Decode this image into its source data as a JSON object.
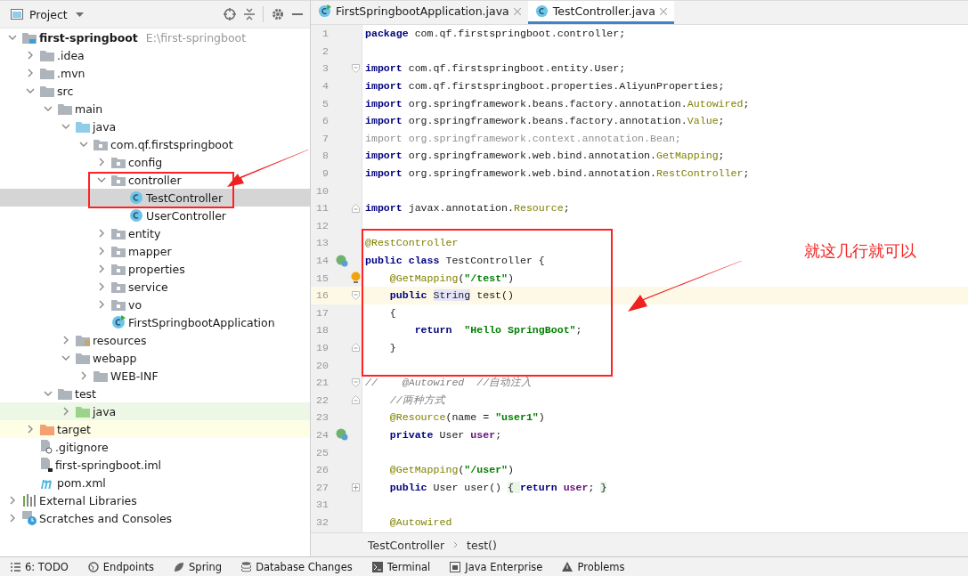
{
  "project_panel": {
    "title": "Project",
    "tree": [
      {
        "label": "first-springboot",
        "path": "E:\\first-springboot",
        "kind": "module",
        "expanded": true,
        "selected": false,
        "children": [
          {
            "label": ".idea",
            "kind": "folder",
            "expanded": false,
            "selected": false
          },
          {
            "label": ".mvn",
            "kind": "folder",
            "expanded": false,
            "selected": false
          },
          {
            "label": "src",
            "kind": "folder",
            "expanded": true,
            "selected": false,
            "children": [
              {
                "label": "main",
                "kind": "folder",
                "expanded": true,
                "selected": false,
                "children": [
                  {
                    "label": "java",
                    "kind": "source",
                    "expanded": true,
                    "selected": false,
                    "children": [
                      {
                        "label": "com.qf.firstspringboot",
                        "kind": "package",
                        "expanded": true,
                        "selected": false,
                        "children": [
                          {
                            "label": "config",
                            "kind": "package",
                            "expanded": false,
                            "selected": false
                          },
                          {
                            "label": "controller",
                            "kind": "package",
                            "expanded": true,
                            "selected": false,
                            "children": [
                              {
                                "label": "TestController",
                                "kind": "class",
                                "selected": true
                              },
                              {
                                "label": "UserController",
                                "kind": "class",
                                "selected": false
                              }
                            ]
                          },
                          {
                            "label": "entity",
                            "kind": "package",
                            "expanded": false,
                            "selected": false
                          },
                          {
                            "label": "mapper",
                            "kind": "package",
                            "expanded": false,
                            "selected": false
                          },
                          {
                            "label": "properties",
                            "kind": "package",
                            "expanded": false,
                            "selected": false
                          },
                          {
                            "label": "service",
                            "kind": "package",
                            "expanded": false,
                            "selected": false
                          },
                          {
                            "label": "vo",
                            "kind": "package",
                            "expanded": false,
                            "selected": false
                          },
                          {
                            "label": "FirstSpringbootApplication",
                            "kind": "app",
                            "selected": false
                          }
                        ]
                      }
                    ]
                  },
                  {
                    "label": "resources",
                    "kind": "resources",
                    "expanded": false,
                    "selected": false
                  },
                  {
                    "label": "webapp",
                    "kind": "folder",
                    "expanded": true,
                    "selected": false,
                    "children": [
                      {
                        "label": "WEB-INF",
                        "kind": "folder",
                        "expanded": false,
                        "selected": false
                      }
                    ]
                  }
                ]
              },
              {
                "label": "test",
                "kind": "folder",
                "expanded": true,
                "selected": false,
                "children": [
                  {
                    "label": "java",
                    "kind": "test-source",
                    "expanded": false,
                    "selected": false
                  }
                ]
              }
            ]
          },
          {
            "label": "target",
            "kind": "excluded",
            "expanded": false,
            "selected": false
          },
          {
            "label": ".gitignore",
            "kind": "ignore-file",
            "selected": false
          },
          {
            "label": "first-springboot.iml",
            "kind": "iml-file",
            "selected": false
          },
          {
            "label": "pom.xml",
            "kind": "maven",
            "selected": false
          }
        ]
      },
      {
        "label": "External Libraries",
        "kind": "libraries",
        "expanded": false,
        "selected": false
      },
      {
        "label": "Scratches and Consoles",
        "kind": "scratches",
        "expanded": false,
        "selected": false
      }
    ]
  },
  "editor": {
    "tabs": [
      {
        "label": "FirstSpringbootApplication.java",
        "kind": "app",
        "selected": false
      },
      {
        "label": "TestController.java",
        "kind": "class",
        "selected": true
      }
    ],
    "lines": [
      {
        "n": "1",
        "tokens": [
          {
            "t": "package",
            "kind": "keyword"
          },
          {
            "t": " com.qf.firstspringboot.controller;",
            "kind": "plain"
          }
        ]
      },
      {
        "n": "2"
      },
      {
        "n": "3",
        "marks": [
          {
            "kind": "fold-start"
          }
        ],
        "tokens": [
          {
            "t": "import",
            "kind": "keyword"
          },
          {
            "t": " com.qf.firstspringboot.entity.User;",
            "kind": "plain"
          }
        ]
      },
      {
        "n": "4",
        "tokens": [
          {
            "t": "import",
            "kind": "keyword"
          },
          {
            "t": " com.qf.firstspringboot.properties.AliyunProperties;",
            "kind": "plain"
          }
        ]
      },
      {
        "n": "5",
        "tokens": [
          {
            "t": "import",
            "kind": "keyword"
          },
          {
            "t": " org.springframework.beans.factory.annotation.",
            "kind": "plain"
          },
          {
            "t": "Autowired",
            "kind": "annotation"
          },
          {
            "t": ";",
            "kind": "plain"
          }
        ]
      },
      {
        "n": "6",
        "tokens": [
          {
            "t": "import",
            "kind": "keyword"
          },
          {
            "t": " org.springframework.beans.factory.annotation.",
            "kind": "plain"
          },
          {
            "t": "Value",
            "kind": "annotation"
          },
          {
            "t": ";",
            "kind": "plain"
          }
        ]
      },
      {
        "n": "7",
        "tokens": [
          {
            "t": "import org.springframework.context.annotation.Bean;",
            "kind": "unused"
          }
        ]
      },
      {
        "n": "8",
        "tokens": [
          {
            "t": "import",
            "kind": "keyword"
          },
          {
            "t": " org.springframework.web.bind.annotation.",
            "kind": "plain"
          },
          {
            "t": "GetMapping",
            "kind": "annotation"
          },
          {
            "t": ";",
            "kind": "plain"
          }
        ]
      },
      {
        "n": "9",
        "tokens": [
          {
            "t": "import",
            "kind": "keyword"
          },
          {
            "t": " org.springframework.web.bind.annotation.",
            "kind": "plain"
          },
          {
            "t": "RestController",
            "kind": "annotation"
          },
          {
            "t": ";",
            "kind": "plain"
          }
        ]
      },
      {
        "n": "10"
      },
      {
        "n": "11",
        "marks": [
          {
            "kind": "fold-end"
          }
        ],
        "tokens": [
          {
            "t": "import",
            "kind": "keyword"
          },
          {
            "t": " javax.annotation.",
            "kind": "plain"
          },
          {
            "t": "Resource",
            "kind": "annotation"
          },
          {
            "t": ";",
            "kind": "plain"
          }
        ]
      },
      {
        "n": "12"
      },
      {
        "n": "13",
        "tokens": [
          {
            "t": "@RestController",
            "kind": "annotation"
          }
        ]
      },
      {
        "n": "14",
        "marks": [
          {
            "kind": "bean"
          }
        ],
        "tokens": [
          {
            "t": "public class",
            "kind": "keyword"
          },
          {
            "t": " TestController {",
            "kind": "plain"
          }
        ]
      },
      {
        "n": "15",
        "marks": [
          {
            "kind": "bulb"
          }
        ],
        "tokens": [
          {
            "t": "    @GetMapping",
            "kind": "annotation"
          },
          {
            "t": "(",
            "kind": "plain"
          },
          {
            "t": "\"/test\"",
            "kind": "string"
          },
          {
            "t": ")",
            "kind": "plain"
          }
        ]
      },
      {
        "n": "16",
        "current": true,
        "marks": [
          {
            "kind": "fold-start"
          }
        ],
        "tokens": [
          {
            "t": "    public ",
            "kind": "keyword"
          },
          {
            "t": "String",
            "kind": "highlight"
          },
          {
            "t": " test()",
            "kind": "plain"
          }
        ]
      },
      {
        "n": "17",
        "tokens": [
          {
            "t": "    {",
            "kind": "plain"
          }
        ]
      },
      {
        "n": "18",
        "tokens": [
          {
            "t": "        return",
            "kind": "keyword"
          },
          {
            "t": "  \"Hello SpringBoot\"",
            "kind": "string"
          },
          {
            "t": ";",
            "kind": "plain"
          }
        ]
      },
      {
        "n": "19",
        "marks": [
          {
            "kind": "fold-end"
          }
        ],
        "tokens": [
          {
            "t": "    }",
            "kind": "plain"
          }
        ]
      },
      {
        "n": "20"
      },
      {
        "n": "21",
        "marks": [
          {
            "kind": "fold-start"
          }
        ],
        "tokens": [
          {
            "t": "//    @Autowired  //自动注入",
            "kind": "comment"
          }
        ]
      },
      {
        "n": "22",
        "marks": [
          {
            "kind": "fold-end"
          }
        ],
        "tokens": [
          {
            "t": "    //两种方式",
            "kind": "comment"
          }
        ]
      },
      {
        "n": "23",
        "tokens": [
          {
            "t": "    @Resource",
            "kind": "annotation"
          },
          {
            "t": "(name = ",
            "kind": "plain"
          },
          {
            "t": "\"user1\"",
            "kind": "string"
          },
          {
            "t": ")",
            "kind": "plain"
          }
        ]
      },
      {
        "n": "24",
        "marks": [
          {
            "kind": "bean"
          }
        ],
        "tokens": [
          {
            "t": "    private",
            "kind": "keyword"
          },
          {
            "t": " User ",
            "kind": "plain"
          },
          {
            "t": "user",
            "kind": "field"
          },
          {
            "t": ";",
            "kind": "plain"
          }
        ]
      },
      {
        "n": "25"
      },
      {
        "n": "26",
        "tokens": [
          {
            "t": "    @GetMapping",
            "kind": "annotation"
          },
          {
            "t": "(",
            "kind": "plain"
          },
          {
            "t": "\"/user\"",
            "kind": "string"
          },
          {
            "t": ")",
            "kind": "plain"
          }
        ]
      },
      {
        "n": "27",
        "marks": [
          {
            "kind": "fold-collapsed"
          }
        ],
        "tokens": [
          {
            "t": "    public",
            "kind": "keyword"
          },
          {
            "t": " User user() ",
            "kind": "plain"
          },
          {
            "t": "{ ",
            "kind": "folded"
          },
          {
            "t": "return",
            "kind": "keyword"
          },
          {
            "t": " user",
            "kind": "field"
          },
          {
            "t": "; ",
            "kind": "plain"
          },
          {
            "t": "}",
            "kind": "folded"
          }
        ]
      },
      {
        "n": "31"
      },
      {
        "n": "32",
        "tokens": [
          {
            "t": "    @Autowired",
            "kind": "annotation"
          }
        ]
      }
    ],
    "breadcrumb": [
      "TestController",
      "test()"
    ]
  },
  "annotation": {
    "text": "就这几行就可以"
  },
  "tool_windows": [
    {
      "label": "6: TODO",
      "kind": "todo"
    },
    {
      "label": "Endpoints",
      "kind": "endpoints"
    },
    {
      "label": "Spring",
      "kind": "spring"
    },
    {
      "label": "Database Changes",
      "kind": "database"
    },
    {
      "label": "Terminal",
      "kind": "terminal"
    },
    {
      "label": "Java Enterprise",
      "kind": "enterprise"
    },
    {
      "label": "Problems",
      "kind": "problems"
    }
  ]
}
